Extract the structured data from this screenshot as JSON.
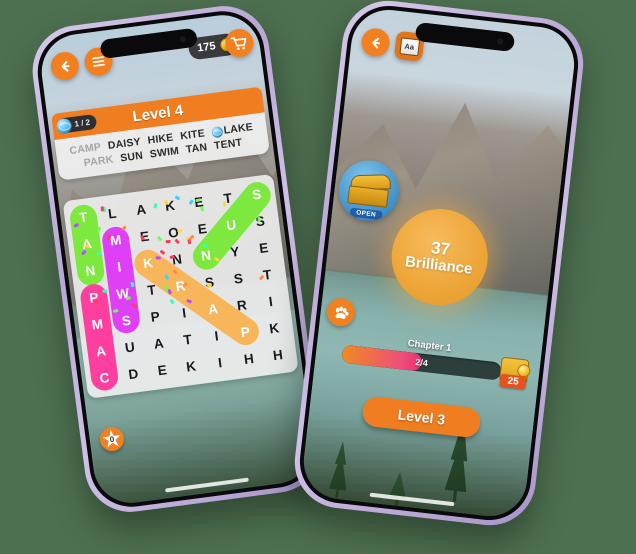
{
  "background_color": "#4d7050",
  "phone_frame_color": "#c3b2dd",
  "accent_color": "#F07E20",
  "left_phone": {
    "topbar": {
      "back_label": "back-arrow",
      "menu_label": "menu",
      "coins": "175",
      "cart_label": "cart"
    },
    "banner": {
      "title": "Level 4",
      "badge_count": "1 / 2"
    },
    "words_row1": [
      "CAMP",
      "DAISY",
      "HIKE",
      "KITE",
      "LAKE"
    ],
    "words_row1_found": [
      true,
      false,
      false,
      false,
      false
    ],
    "words_row1_globe": [
      false,
      false,
      false,
      false,
      true
    ],
    "words_row2": [
      "PARK",
      "SUN",
      "SWIM",
      "TAN",
      "TENT"
    ],
    "words_row2_found": [
      true,
      false,
      false,
      false,
      false
    ],
    "grid": [
      [
        "T",
        "L",
        "A",
        "K",
        "E",
        "T",
        "S"
      ],
      [
        "A",
        "M",
        "E",
        "O",
        "E",
        "U",
        "S"
      ],
      [
        "N",
        "I",
        "K",
        "N",
        "N",
        "Y",
        "E"
      ],
      [
        "P",
        "W",
        "T",
        "R",
        "S",
        "S",
        "T"
      ],
      [
        "M",
        "S",
        "P",
        "I",
        "A",
        "R",
        "I"
      ],
      [
        "A",
        "U",
        "A",
        "T",
        "I",
        "P",
        "K"
      ],
      [
        "C",
        "D",
        "E",
        "K",
        "I",
        "H",
        "H"
      ]
    ],
    "highlights": [
      {
        "word": "TAN",
        "color": "#7DE83E",
        "cells": [
          [
            0,
            0
          ],
          [
            1,
            0
          ],
          [
            2,
            0
          ]
        ]
      },
      {
        "word": "MIWS",
        "color": "#E040F5",
        "cells": [
          [
            1,
            1
          ],
          [
            2,
            1
          ],
          [
            3,
            1
          ],
          [
            4,
            1
          ]
        ]
      },
      {
        "word": "PMAC",
        "color": "#FF3FA0",
        "cells": [
          [
            3,
            0
          ],
          [
            4,
            0
          ],
          [
            5,
            0
          ],
          [
            6,
            0
          ]
        ]
      },
      {
        "word": "SUN",
        "color": "#7DE83E",
        "cells": [
          [
            0,
            6
          ],
          [
            1,
            5
          ],
          [
            2,
            4
          ]
        ]
      },
      {
        "word": "KRAP",
        "color": "#F7B65A",
        "cells": [
          [
            2,
            2
          ],
          [
            3,
            3
          ],
          [
            4,
            4
          ],
          [
            5,
            5
          ]
        ]
      }
    ],
    "star_badge": "0"
  },
  "right_phone": {
    "topbar": {
      "back_label": "back-arrow",
      "dictionary_label": "Aa"
    },
    "chest": {
      "tag": "OPEN"
    },
    "brilliance": {
      "value": "37",
      "label": "Brilliance"
    },
    "paw_label": "paw",
    "chapter_label": "Chapter 1",
    "progress": {
      "text": "2/4",
      "percent": 50
    },
    "reward": {
      "coins": "25"
    },
    "level_button": "Level 3"
  }
}
